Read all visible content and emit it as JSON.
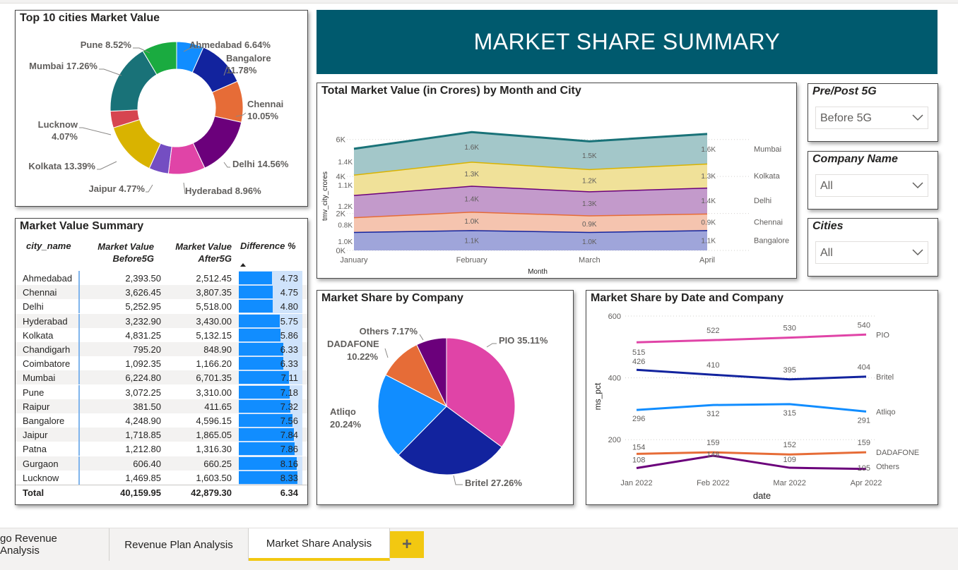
{
  "banner": {
    "title": "MARKET SHARE SUMMARY"
  },
  "donut": {
    "title": "Top 10 cities Market Value",
    "slices": [
      {
        "name": "Ahmedabad",
        "pct": 6.64,
        "color": "#118DFF",
        "label": "Ahmedabad 6.64%"
      },
      {
        "name": "Bangalore",
        "pct": 11.78,
        "color": "#12239E",
        "label1": "Bangalore",
        "label2": "11.78%"
      },
      {
        "name": "Chennai",
        "pct": 10.05,
        "color": "#E66C37",
        "label1": "Chennai",
        "label2": "10.05%"
      },
      {
        "name": "Delhi",
        "pct": 14.56,
        "color": "#6B007B",
        "label": "Delhi 14.56%"
      },
      {
        "name": "Hyderabad",
        "pct": 8.96,
        "color": "#E044A7",
        "label": "Hyderabad 8.96%"
      },
      {
        "name": "Jaipur",
        "pct": 4.77,
        "color": "#744EC2",
        "label": "Jaipur 4.77%"
      },
      {
        "name": "Kolkata",
        "pct": 13.39,
        "color": "#D9B300",
        "label": "Kolkata 13.39%"
      },
      {
        "name": "Lucknow",
        "pct": 4.07,
        "color": "#D64550",
        "label1": "Lucknow",
        "label2": "4.07%"
      },
      {
        "name": "Mumbai",
        "pct": 17.26,
        "color": "#197278",
        "label": "Mumbai 17.26%"
      },
      {
        "name": "Pune",
        "pct": 8.52,
        "color": "#1AAB40",
        "label": "Pune 8.52%"
      }
    ]
  },
  "summary": {
    "title": "Market Value Summary",
    "headers": {
      "city": "city_name",
      "before1": "Market Value",
      "before2": "Before5G",
      "after1": "Market Value",
      "after2": "After5G",
      "diff": "Difference %"
    },
    "rows": [
      {
        "city": "Ahmedabad",
        "before": "2,393.50",
        "after": "2,512.45",
        "diff": "4.73",
        "d": 4.73
      },
      {
        "city": "Chennai",
        "before": "3,626.45",
        "after": "3,807.35",
        "diff": "4.75",
        "d": 4.75
      },
      {
        "city": "Delhi",
        "before": "5,252.95",
        "after": "5,518.00",
        "diff": "4.80",
        "d": 4.8
      },
      {
        "city": "Hyderabad",
        "before": "3,232.90",
        "after": "3,430.00",
        "diff": "5.75",
        "d": 5.75
      },
      {
        "city": "Kolkata",
        "before": "4,831.25",
        "after": "5,132.15",
        "diff": "5.86",
        "d": 5.86
      },
      {
        "city": "Chandigarh",
        "before": "795.20",
        "after": "848.90",
        "diff": "6.33",
        "d": 6.33
      },
      {
        "city": "Coimbatore",
        "before": "1,092.35",
        "after": "1,166.20",
        "diff": "6.33",
        "d": 6.33
      },
      {
        "city": "Mumbai",
        "before": "6,224.80",
        "after": "6,701.35",
        "diff": "7.11",
        "d": 7.11
      },
      {
        "city": "Pune",
        "before": "3,072.25",
        "after": "3,310.00",
        "diff": "7.18",
        "d": 7.18
      },
      {
        "city": "Raipur",
        "before": "381.50",
        "after": "411.65",
        "diff": "7.32",
        "d": 7.32
      },
      {
        "city": "Bangalore",
        "before": "4,248.90",
        "after": "4,596.15",
        "diff": "7.56",
        "d": 7.56
      },
      {
        "city": "Jaipur",
        "before": "1,718.85",
        "after": "1,865.05",
        "diff": "7.84",
        "d": 7.84
      },
      {
        "city": "Patna",
        "before": "1,212.80",
        "after": "1,316.30",
        "diff": "7.86",
        "d": 7.86
      },
      {
        "city": "Gurgaon",
        "before": "606.40",
        "after": "660.25",
        "diff": "8.16",
        "d": 8.16
      },
      {
        "city": "Lucknow",
        "before": "1,469.85",
        "after": "1,603.50",
        "diff": "8.33",
        "d": 8.33
      }
    ],
    "total": {
      "city": "Total",
      "before": "40,159.95",
      "after": "42,879.30",
      "diff": "6.34"
    }
  },
  "area": {
    "title": "Total Market Value (in Crores) by Month and City",
    "ylabel": "tmv_city_crores",
    "xlabel": "Month",
    "months": [
      "January",
      "February",
      "March",
      "April"
    ],
    "yticks": [
      "0K",
      "2K",
      "4K",
      "6K"
    ],
    "layers": [
      {
        "name": "Bangalore",
        "values": [
          1.0,
          1.1,
          1.0,
          1.1
        ],
        "labels": [
          "1.0K",
          "1.1K",
          "1.0K",
          "1.1K"
        ],
        "fill": "#9FA5DA",
        "line": "#12239E"
      },
      {
        "name": "Chennai",
        "values": [
          0.8,
          1.0,
          0.9,
          0.9
        ],
        "labels": [
          "0.8K",
          "1.0K",
          "0.9K",
          "0.9K"
        ],
        "fill": "#F5C4AF",
        "line": "#E66C37"
      },
      {
        "name": "Delhi",
        "values": [
          1.2,
          1.4,
          1.3,
          1.4
        ],
        "labels": [
          "1.2K",
          "1.4K",
          "1.3K",
          "1.4K"
        ],
        "fill": "#C39ACB",
        "line": "#6B007B"
      },
      {
        "name": "Kolkata",
        "values": [
          1.1,
          1.3,
          1.2,
          1.3
        ],
        "labels": [
          "1.1K",
          "1.3K",
          "1.2K",
          "1.3K"
        ],
        "fill": "#F0E199",
        "line": "#D9B300"
      },
      {
        "name": "Mumbai",
        "values": [
          1.4,
          1.6,
          1.5,
          1.6
        ],
        "labels": [
          "1.4K",
          "1.6K",
          "1.5K",
          "1.6K"
        ],
        "fill": "#A3C7C9",
        "line": "#197278"
      }
    ]
  },
  "slicers": [
    {
      "title": "Pre/Post 5G",
      "value": "Before 5G"
    },
    {
      "title": "Company Name",
      "value": "All"
    },
    {
      "title": "Cities",
      "value": "All"
    }
  ],
  "pie": {
    "title": "Market Share by Company",
    "slices": [
      {
        "name": "PIO",
        "pct": 35.11,
        "color": "#E044A7",
        "label": "PIO 35.11%"
      },
      {
        "name": "Britel",
        "pct": 27.26,
        "color": "#12239E",
        "label": "Britel 27.26%"
      },
      {
        "name": "Atliqo",
        "pct": 20.24,
        "color": "#118DFF",
        "label1": "Atliqo",
        "label2": "20.24%"
      },
      {
        "name": "DADAFONE",
        "pct": 10.22,
        "color": "#E66C37",
        "label1": "DADAFONE",
        "label2": "10.22%"
      },
      {
        "name": "Others",
        "pct": 7.17,
        "color": "#6B007B",
        "label": "Others 7.17%"
      }
    ]
  },
  "line": {
    "title": "Market Share by Date and Company",
    "ylabel": "ms_pct",
    "xlabel": "date",
    "dates": [
      "Jan 2022",
      "Feb 2022",
      "Mar 2022",
      "Apr 2022"
    ],
    "yticks": [
      "200",
      "400",
      "600"
    ],
    "series": [
      {
        "name": "PIO",
        "values": [
          515,
          522,
          530,
          540
        ],
        "color": "#E044A7"
      },
      {
        "name": "Britel",
        "values": [
          426,
          410,
          395,
          404
        ],
        "color": "#12239E"
      },
      {
        "name": "Atliqo",
        "values": [
          296,
          312,
          315,
          291
        ],
        "color": "#118DFF"
      },
      {
        "name": "DADAFONE",
        "values": [
          154,
          159,
          152,
          159
        ],
        "color": "#E66C37"
      },
      {
        "name": "Others",
        "values": [
          108,
          148,
          109,
          105
        ],
        "color": "#6B007B"
      }
    ]
  },
  "tabs": [
    {
      "label": "go Revenue Analysis"
    },
    {
      "label": "Revenue Plan Analysis"
    },
    {
      "label": "Market Share Analysis"
    }
  ],
  "add_tab": "+",
  "chart_data": [
    {
      "type": "pie",
      "title": "Top 10 cities Market Value",
      "categories": [
        "Ahmedabad",
        "Bangalore",
        "Chennai",
        "Delhi",
        "Hyderabad",
        "Jaipur",
        "Kolkata",
        "Lucknow",
        "Mumbai",
        "Pune"
      ],
      "values": [
        6.64,
        11.78,
        10.05,
        14.56,
        8.96,
        4.77,
        13.39,
        4.07,
        17.26,
        8.52
      ]
    },
    {
      "type": "area",
      "title": "Total Market Value (in Crores) by Month and City",
      "categories": [
        "January",
        "February",
        "March",
        "April"
      ],
      "xlabel": "Month",
      "ylabel": "tmv_city_crores",
      "ylim": [
        0,
        6600
      ],
      "series": [
        {
          "name": "Bangalore",
          "values": [
            1000,
            1100,
            1000,
            1100
          ]
        },
        {
          "name": "Chennai",
          "values": [
            800,
            1000,
            900,
            900
          ]
        },
        {
          "name": "Delhi",
          "values": [
            1200,
            1400,
            1300,
            1400
          ]
        },
        {
          "name": "Kolkata",
          "values": [
            1100,
            1300,
            1200,
            1300
          ]
        },
        {
          "name": "Mumbai",
          "values": [
            1400,
            1600,
            1500,
            1600
          ]
        }
      ]
    },
    {
      "type": "pie",
      "title": "Market Share by Company",
      "categories": [
        "PIO",
        "Britel",
        "Atliqo",
        "DADAFONE",
        "Others"
      ],
      "values": [
        35.11,
        27.26,
        20.24,
        10.22,
        7.17
      ]
    },
    {
      "type": "line",
      "title": "Market Share by Date and Company",
      "categories": [
        "Jan 2022",
        "Feb 2022",
        "Mar 2022",
        "Apr 2022"
      ],
      "xlabel": "date",
      "ylabel": "ms_pct",
      "ylim": [
        100,
        600
      ],
      "series": [
        {
          "name": "PIO",
          "values": [
            515,
            522,
            530,
            540
          ]
        },
        {
          "name": "Britel",
          "values": [
            426,
            410,
            395,
            404
          ]
        },
        {
          "name": "Atliqo",
          "values": [
            296,
            312,
            315,
            291
          ]
        },
        {
          "name": "DADAFONE",
          "values": [
            154,
            159,
            152,
            159
          ]
        },
        {
          "name": "Others",
          "values": [
            108,
            148,
            109,
            105
          ]
        }
      ]
    },
    {
      "type": "table",
      "title": "Market Value Summary",
      "columns": [
        "city_name",
        "Market Value Before5G",
        "Market Value After5G",
        "Difference %"
      ]
    }
  ]
}
